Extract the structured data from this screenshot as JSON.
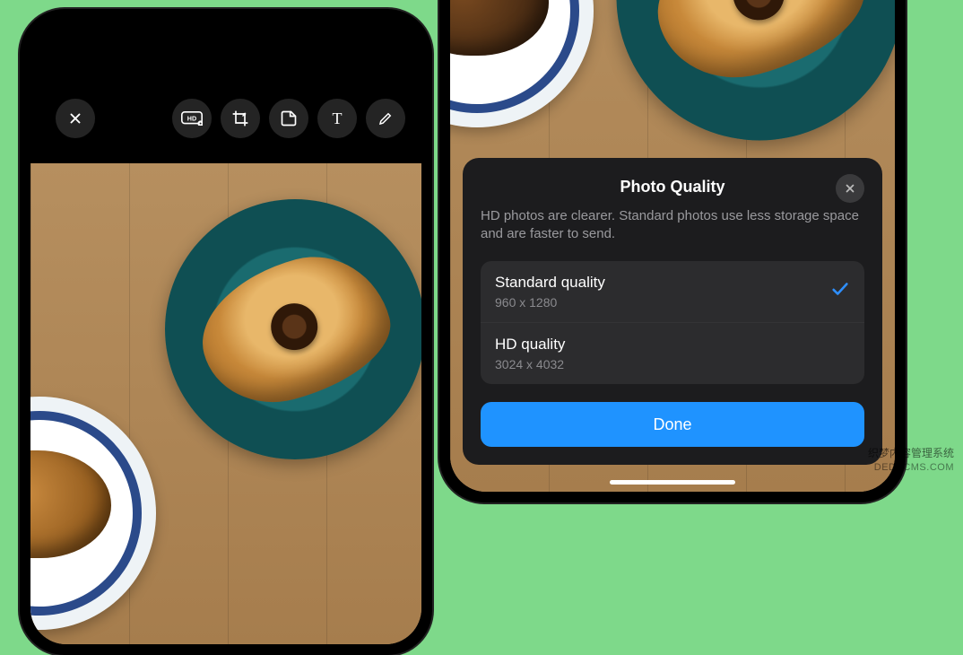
{
  "editor": {
    "tools": {
      "close": "close-icon",
      "hd": "hd-icon",
      "crop": "crop-icon",
      "sticker": "sticker-icon",
      "text_tool": "T",
      "draw": "pencil-icon"
    }
  },
  "sheet": {
    "title": "Photo Quality",
    "description": "HD photos are clearer. Standard photos use less storage space and are faster to send.",
    "options": [
      {
        "title": "Standard quality",
        "subtitle": "960 x 1280",
        "selected": true
      },
      {
        "title": "HD quality",
        "subtitle": "3024 x 4032",
        "selected": false
      }
    ],
    "done_label": "Done"
  },
  "watermark": {
    "line1": "织梦内容管理系统",
    "line2": "DEDECMS.COM"
  }
}
